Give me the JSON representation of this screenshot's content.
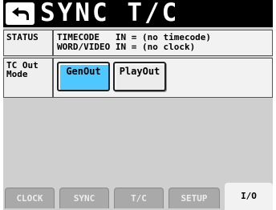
{
  "header": {
    "title": "SYNC T/C",
    "back_icon": "return-arrow-icon"
  },
  "status": {
    "label": "STATUS",
    "line1": "TIMECODE   IN = (no timecode)",
    "line2": "WORD/VIDEO IN = (no clock)"
  },
  "tc_out_mode": {
    "label_line1": "TC Out",
    "label_line2": "Mode",
    "options": [
      "GenOut",
      "PlayOut"
    ],
    "selected": "GenOut"
  },
  "tabs": {
    "clock": "CLOCK",
    "sync": "SYNC",
    "tc": "T/C",
    "setup": "SETUP",
    "io": "I/O",
    "active": "I/O"
  },
  "colors": {
    "title_bar": "#000000",
    "selected_option": "#4ec8ff",
    "background": "#cfcfcf"
  }
}
